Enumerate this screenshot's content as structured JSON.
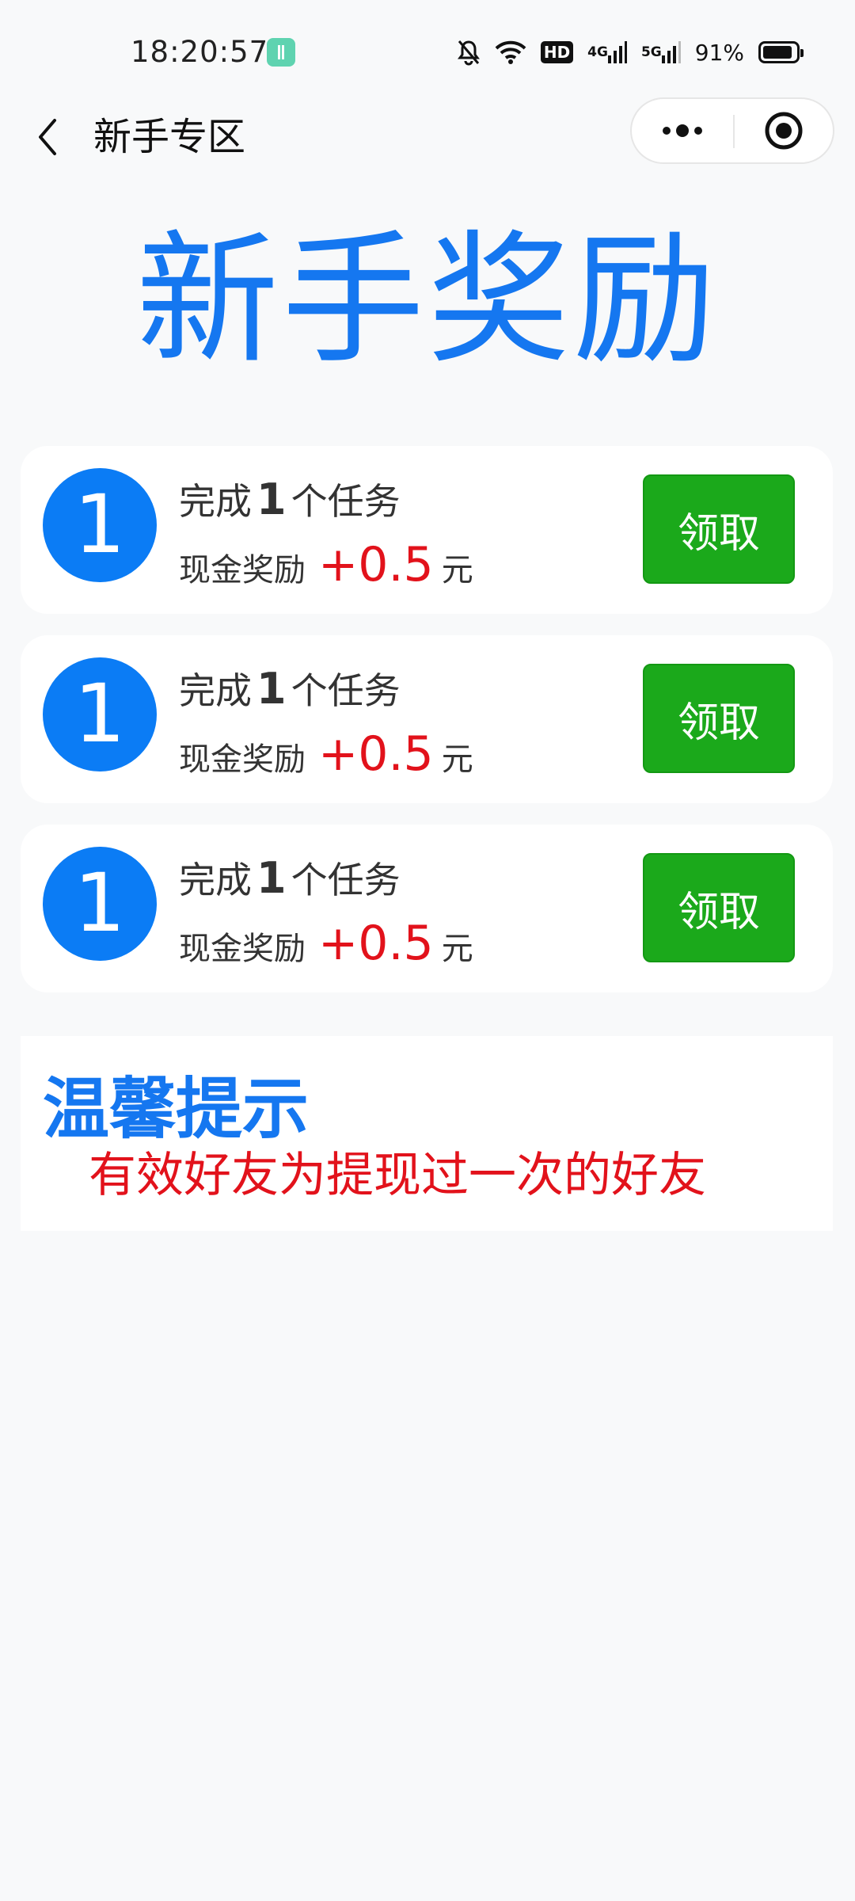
{
  "status_bar": {
    "time": "18:20:57",
    "hd_label": "HD",
    "network_1": "4G",
    "network_2": "5G",
    "battery_percent": "91%",
    "battery_level": 0.91
  },
  "nav": {
    "title": "新手专区"
  },
  "hero": {
    "title": "新手奖励"
  },
  "tasks": [
    {
      "index": "1",
      "prefix": "完成",
      "count": "1",
      "suffix": "个任务",
      "reward_label": "现金奖励",
      "reward_amount": "+0.5",
      "reward_unit": "元",
      "button_label": "领取"
    },
    {
      "index": "1",
      "prefix": "完成",
      "count": "1",
      "suffix": "个任务",
      "reward_label": "现金奖励",
      "reward_amount": "+0.5",
      "reward_unit": "元",
      "button_label": "领取"
    },
    {
      "index": "1",
      "prefix": "完成",
      "count": "1",
      "suffix": "个任务",
      "reward_label": "现金奖励",
      "reward_amount": "+0.5",
      "reward_unit": "元",
      "button_label": "领取"
    }
  ],
  "tips": {
    "title": "温馨提示",
    "text": "有效好友为提现过一次的好友"
  },
  "colors": {
    "accent_blue": "#1577f0",
    "circle_blue": "#0b7cf5",
    "button_green": "#1ba91b",
    "reward_red": "#e2121b"
  }
}
